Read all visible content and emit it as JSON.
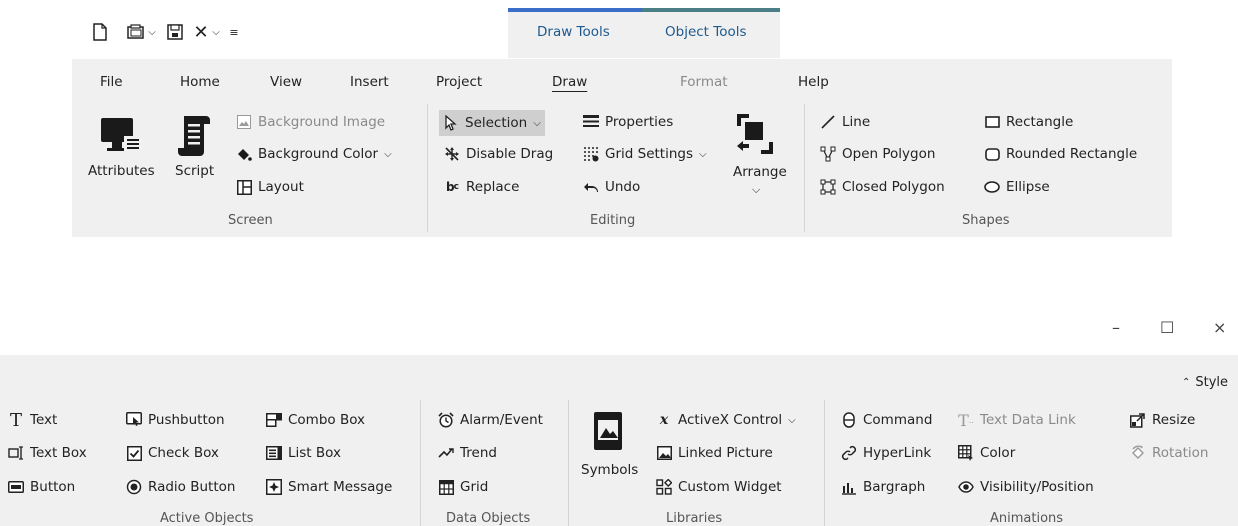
{
  "contextual_tabs": {
    "draw_tools": "Draw Tools",
    "object_tools": "Object Tools",
    "draw_color": "#3a6fc9",
    "object_color": "#4b7f87"
  },
  "tabs": {
    "file": "File",
    "home": "Home",
    "view": "View",
    "insert": "Insert",
    "project": "Project",
    "draw": "Draw",
    "format": "Format",
    "help": "Help"
  },
  "screen": {
    "attributes": "Attributes",
    "script": "Script",
    "background_image": "Background Image",
    "background_color": "Background Color",
    "layout": "Layout",
    "group": "Screen"
  },
  "editing": {
    "selection": "Selection",
    "disable_drag": "Disable Drag",
    "replace": "Replace",
    "properties": "Properties",
    "grid_settings": "Grid Settings",
    "undo": "Undo",
    "arrange": "Arrange",
    "group": "Editing"
  },
  "shapes": {
    "line": "Line",
    "open_polygon": "Open Polygon",
    "closed_polygon": "Closed Polygon",
    "rectangle": "Rectangle",
    "rounded_rectangle": "Rounded Rectangle",
    "ellipse": "Ellipse",
    "group": "Shapes"
  },
  "window_controls": {
    "minimize": "–",
    "maximize": "☐",
    "close": "×"
  },
  "style_label": "Style",
  "active_objects": {
    "text": "Text",
    "text_box": "Text Box",
    "button": "Button",
    "pushbutton": "Pushbutton",
    "check_box": "Check Box",
    "radio_button": "Radio Button",
    "combo_box": "Combo Box",
    "list_box": "List Box",
    "smart_message": "Smart Message",
    "group": "Active Objects"
  },
  "data_objects": {
    "alarm_event": "Alarm/Event",
    "trend": "Trend",
    "grid": "Grid",
    "group": "Data Objects"
  },
  "libraries": {
    "symbols": "Symbols",
    "activex_control": "ActiveX Control",
    "linked_picture": "Linked Picture",
    "custom_widget": "Custom Widget",
    "group": "Libraries"
  },
  "animations": {
    "command": "Command",
    "hyperlink": "HyperLink",
    "bargraph": "Bargraph",
    "text_data_link": "Text Data Link",
    "color": "Color",
    "visibility_position": "Visibility/Position",
    "resize": "Resize",
    "rotation": "Rotation",
    "group": "Animations"
  }
}
